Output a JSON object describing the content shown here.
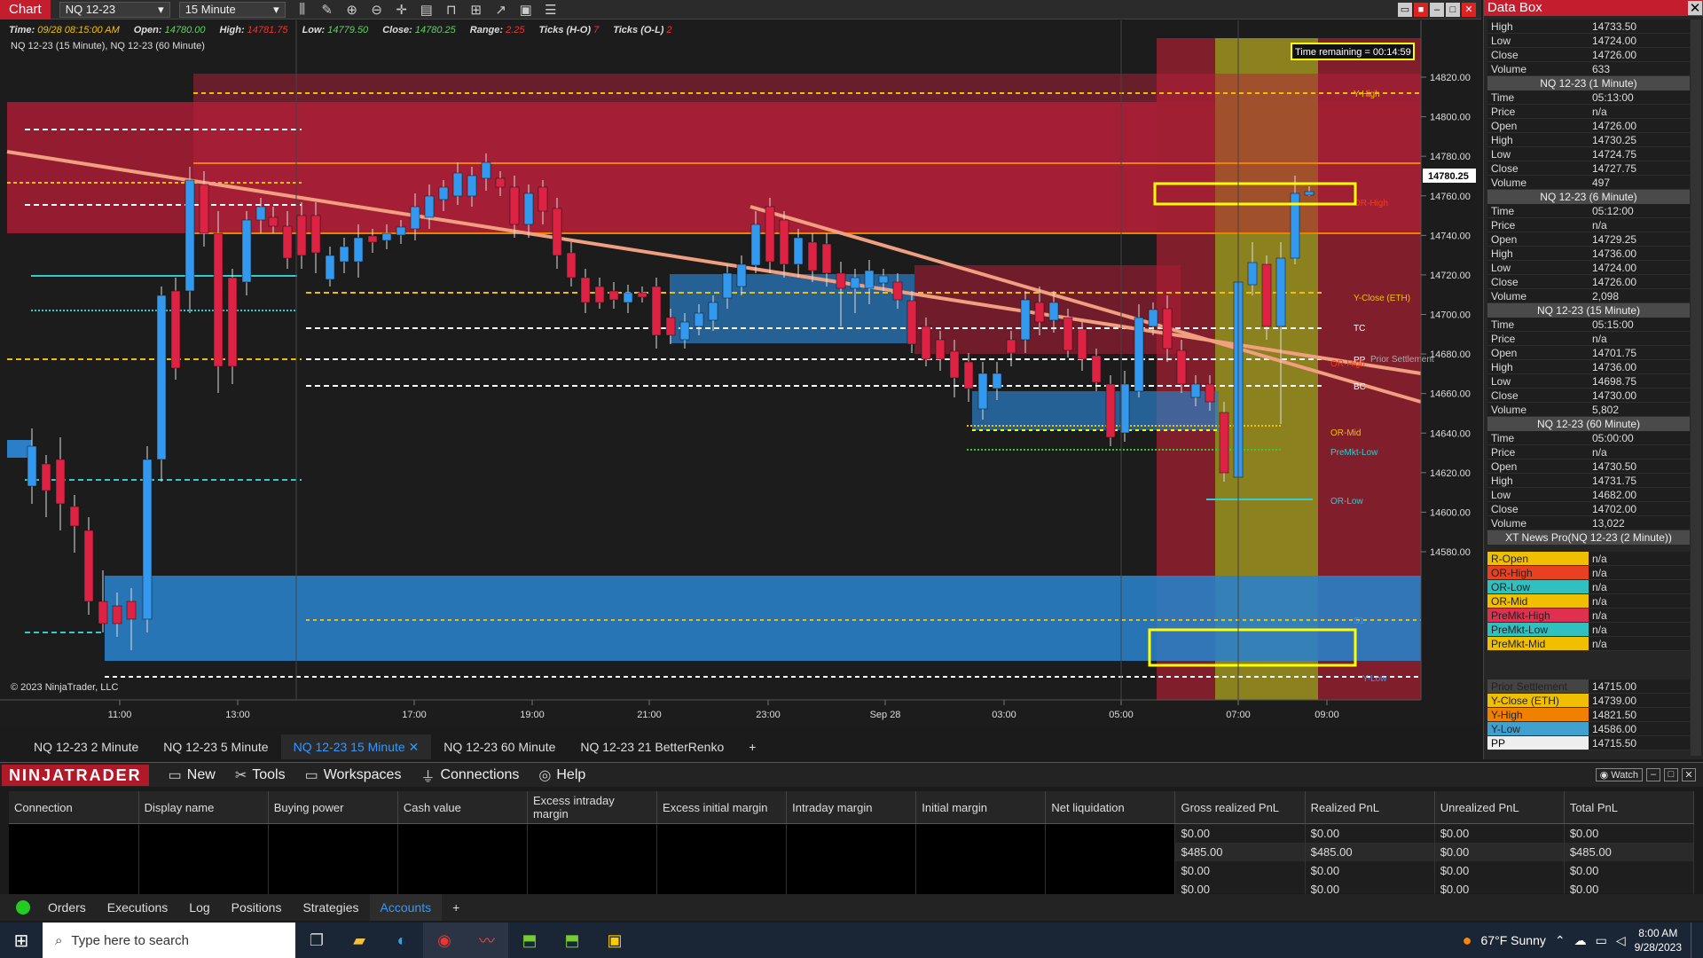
{
  "topbar": {
    "chart_tab": "Chart",
    "instrument": "NQ 12-23",
    "interval": "15 Minute"
  },
  "infobar": {
    "time_label": "Time:",
    "time": "09/28 08:15:00 AM",
    "open_label": "Open:",
    "open": "14780.00",
    "high_label": "High:",
    "high": "14781.75",
    "low_label": "Low:",
    "low": "14779.50",
    "close_label": "Close:",
    "close": "14780.25",
    "range_label": "Range:",
    "range": "2.25",
    "ticks_ho_label": "Ticks (H-O)",
    "ticks_ho": "7",
    "ticks_ol_label": "Ticks (O-L)",
    "ticks_ol": "2"
  },
  "chart": {
    "series_label": "NQ 12-23 (15 Minute), NQ 12-23 (60 Minute)",
    "copyright": "© 2023 NinjaTrader, LLC",
    "time_remaining": "Time remaining = 00:14:59",
    "last_price": "14780.25",
    "y_ticks": [
      "14820.00",
      "14800.00",
      "14780.00",
      "14760.00",
      "14740.00",
      "14720.00",
      "14700.00",
      "14680.00",
      "14660.00",
      "14640.00",
      "14620.00",
      "14600.00",
      "14580.00"
    ],
    "x_ticks": [
      "11:00",
      "13:00",
      "17:00",
      "19:00",
      "21:00",
      "23:00",
      "Sep 28",
      "03:00",
      "05:00",
      "07:00",
      "09:00"
    ],
    "level_labels": {
      "y_high": "Y-High",
      "or_high_top": "OR-High",
      "y_close": "Y-Close (ETH)",
      "tc": "TC",
      "pp": "PP",
      "prior_settlement": "Prior Settlement",
      "or_high": "OR-High",
      "bc": "BC",
      "or_mid": "OR-Mid",
      "premkt_low": "PreMkt-Low",
      "or_low": "OR-Low",
      "s1": "S1",
      "y_low": "Y-Low"
    }
  },
  "colors": {
    "up": "#3399ee",
    "down": "#dd2244",
    "red_zone": "#a81c34",
    "blue_zone": "#2a7fc8",
    "session": "#8c8c1e",
    "trend": "#f0a080"
  },
  "subtabs": [
    "NQ 12-23 2 Minute",
    "NQ 12-23 5 Minute",
    "NQ 12-23 15 Minute",
    "NQ 12-23 60 Minute",
    "NQ 12-23 21 BetterRenko",
    "+"
  ],
  "ntbar": {
    "logo": "NINJATRADER",
    "menu": [
      "New",
      "Tools",
      "Workspaces",
      "Connections",
      "Help"
    ],
    "watch": "Watch"
  },
  "accounts": {
    "headers": [
      "Connection",
      "Display name",
      "Buying power",
      "Cash value",
      "Excess intraday margin",
      "Excess initial margin",
      "Intraday margin",
      "Initial margin",
      "Net liquidation",
      "Gross realized PnL",
      "Realized PnL",
      "Unrealized PnL",
      "Total PnL"
    ],
    "rows": [
      [
        "$0.00",
        "$0.00",
        "$0.00",
        "$0.00"
      ],
      [
        "$485.00",
        "$485.00",
        "$0.00",
        "$485.00"
      ],
      [
        "$0.00",
        "$0.00",
        "$0.00",
        "$0.00"
      ],
      [
        "$0.00",
        "$0.00",
        "$0.00",
        "$0.00"
      ]
    ]
  },
  "bottomtabs": [
    "Orders",
    "Executions",
    "Log",
    "Positions",
    "Strategies",
    "Accounts",
    "+"
  ],
  "taskbar": {
    "search": "Type here to search",
    "weather": "67°F  Sunny",
    "time": "8:00 AM",
    "date": "9/28/2023"
  },
  "databox": {
    "title": "Data Box",
    "top_rows": [
      [
        "High",
        "14733.50"
      ],
      [
        "Low",
        "14724.00"
      ],
      [
        "Close",
        "14726.00"
      ],
      [
        "Volume",
        "633"
      ]
    ],
    "sections": [
      {
        "name": "NQ 12-23 (1 Minute)",
        "rows": [
          [
            "Time",
            "05:13:00"
          ],
          [
            "Price",
            "n/a"
          ],
          [
            "Open",
            "14726.00"
          ],
          [
            "High",
            "14730.25"
          ],
          [
            "Low",
            "14724.75"
          ],
          [
            "Close",
            "14727.75"
          ],
          [
            "Volume",
            "497"
          ]
        ]
      },
      {
        "name": "NQ 12-23 (6 Minute)",
        "rows": [
          [
            "Time",
            "05:12:00"
          ],
          [
            "Price",
            "n/a"
          ],
          [
            "Open",
            "14729.25"
          ],
          [
            "High",
            "14736.00"
          ],
          [
            "Low",
            "14724.00"
          ],
          [
            "Close",
            "14726.00"
          ],
          [
            "Volume",
            "2,098"
          ]
        ]
      },
      {
        "name": "NQ 12-23 (15 Minute)",
        "rows": [
          [
            "Time",
            "05:15:00"
          ],
          [
            "Price",
            "n/a"
          ],
          [
            "Open",
            "14701.75"
          ],
          [
            "High",
            "14736.00"
          ],
          [
            "Low",
            "14698.75"
          ],
          [
            "Close",
            "14730.00"
          ],
          [
            "Volume",
            "5,802"
          ]
        ]
      },
      {
        "name": "NQ 12-23 (60 Minute)",
        "rows": [
          [
            "Time",
            "05:00:00"
          ],
          [
            "Price",
            "n/a"
          ],
          [
            "Open",
            "14730.50"
          ],
          [
            "High",
            "14731.75"
          ],
          [
            "Low",
            "14682.00"
          ],
          [
            "Close",
            "14702.00"
          ],
          [
            "Volume",
            "13,022"
          ]
        ]
      }
    ],
    "news": "XT News Pro(NQ 12-23 (2 Minute))",
    "levels": [
      [
        "R-Open",
        "n/a",
        "#f0c000"
      ],
      [
        "OR-High",
        "n/a",
        "#e84020"
      ],
      [
        "OR-Low",
        "n/a",
        "#30c0c0"
      ],
      [
        "OR-Mid",
        "n/a",
        "#f0c000"
      ],
      [
        "PreMkt-High",
        "n/a",
        "#e03050"
      ],
      [
        "PreMkt-Low",
        "n/a",
        "#30c0c0"
      ],
      [
        "PreMkt-Mid",
        "n/a",
        "#f0c000"
      ]
    ],
    "prior": [
      [
        "Prior Settlement",
        "14715.00",
        "#444"
      ],
      [
        "Y-Close (ETH)",
        "14739.00",
        "#f0c000"
      ],
      [
        "Y-High",
        "14821.50",
        "#f08000"
      ],
      [
        "Y-Low",
        "14586.00",
        "#40a0d0"
      ],
      [
        "PP",
        "14715.50",
        "#eee"
      ]
    ]
  }
}
